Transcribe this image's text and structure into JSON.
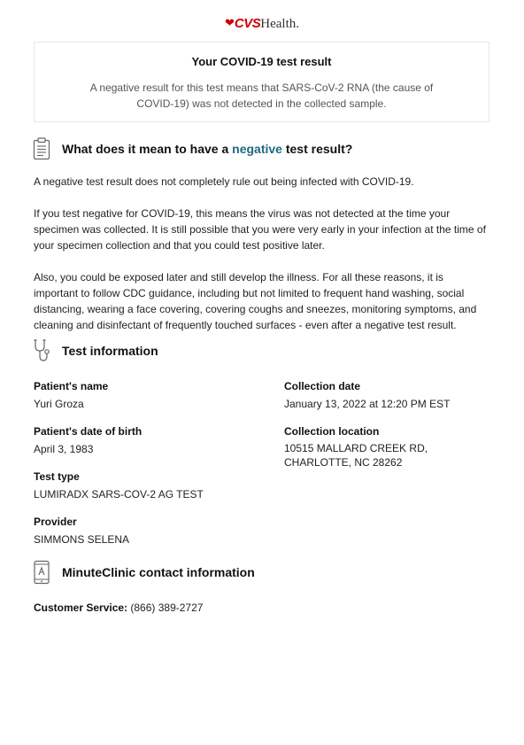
{
  "logo": {
    "heart": "❤",
    "cvs": "CVS",
    "health": "Health."
  },
  "result": {
    "title": "Your COVID-19 test result",
    "text": "A negative result for this test means that SARS-CoV-2 RNA (the cause of COVID-19) was not detected in the collected sample."
  },
  "meaning": {
    "heading_pre": "What does it mean to have a ",
    "heading_highlight": "negative",
    "heading_post": " test result?",
    "p1": "A negative test result does not completely rule out being infected with COVID-19.",
    "p2": "If you test negative for COVID-19, this means the virus was not detected at the time your specimen was collected. It is still possible that you were very early in your infection at the time of your specimen collection and that you could test positive later.",
    "p3": "Also, you could be exposed later and still develop the illness. For all these reasons, it is important to follow CDC guidance, including but not limited to frequent hand washing, social distancing, wearing a face covering, covering coughs and sneezes, monitoring symptoms, and cleaning and disinfectant of frequently touched surfaces - even after a negative test result."
  },
  "test_info": {
    "heading": "Test information",
    "patient_name_label": "Patient's name",
    "patient_name": "Yuri Groza",
    "dob_label": "Patient's date of birth",
    "dob": "April 3, 1983",
    "test_type_label": "Test type",
    "test_type": "LUMIRADX SARS-COV-2 AG TEST",
    "provider_label": "Provider",
    "provider": "SIMMONS SELENA",
    "collection_date_label": "Collection date",
    "collection_date": "January 13, 2022 at 12:20 PM EST",
    "collection_location_label": "Collection location",
    "collection_location_line1": "10515 MALLARD CREEK RD,",
    "collection_location_line2": "CHARLOTTE, NC 28262"
  },
  "contact": {
    "heading": "MinuteClinic contact information",
    "label": "Customer Service:",
    "phone": "(866) 389-2727"
  },
  "colors": {
    "brand_red": "#cc0000",
    "highlight": "#1f6b82"
  },
  "icons": [
    "clipboard-icon",
    "stethoscope-icon",
    "phone-icon"
  ]
}
